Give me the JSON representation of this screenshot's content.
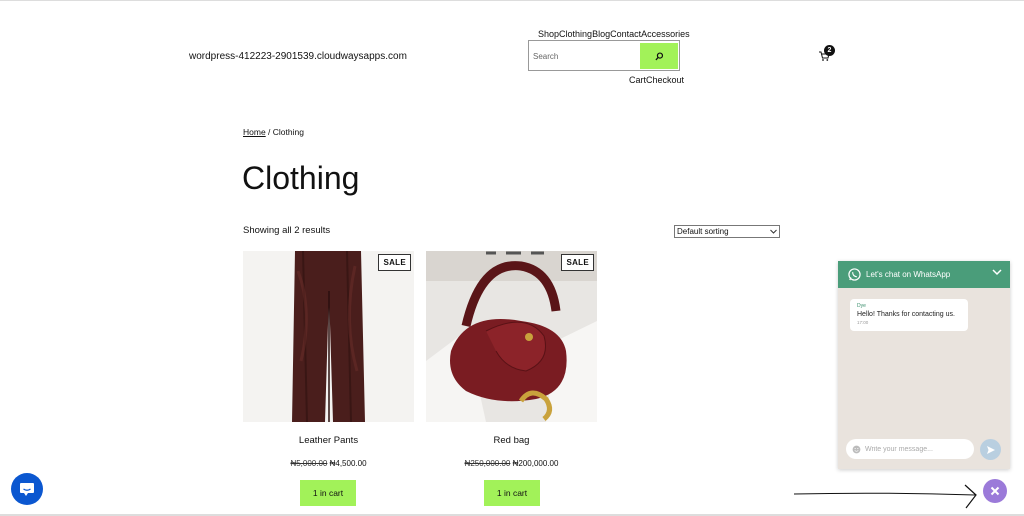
{
  "header": {
    "site_title": "wordpress-412223-2901539.cloudwaysapps.com",
    "nav_top": [
      "Shop",
      "Clothing",
      "Blog",
      "Contact",
      "Accessories"
    ],
    "nav_bottom": [
      "Cart",
      "Checkout"
    ],
    "search_placeholder": "Search",
    "cart_count": "2"
  },
  "breadcrumb": {
    "home": "Home",
    "separator": " / ",
    "current": "Clothing"
  },
  "page_title": "Clothing",
  "result_count": "Showing all 2 results",
  "sorting": {
    "selected": "Default sorting"
  },
  "products": [
    {
      "name": "Leather Pants",
      "old_price": "₦5,000.00",
      "price": "₦4,500.00",
      "badge": "SALE",
      "button": "1 in cart"
    },
    {
      "name": "Red bag",
      "old_price": "₦250,000.00",
      "price": "₦200,000.00",
      "badge": "SALE",
      "button": "1 in cart"
    }
  ],
  "whatsapp": {
    "title": "Let's chat on WhatsApp",
    "agent": "Dye",
    "message": "Hello! Thanks for contacting us.",
    "time": "17:00",
    "input_placeholder": "Write your message..."
  },
  "colors": {
    "accent_green": "#a2f259",
    "whatsapp_green": "#4a9d7a",
    "launcher_blue": "#0b57d0",
    "close_purple": "#9b7ad9"
  }
}
